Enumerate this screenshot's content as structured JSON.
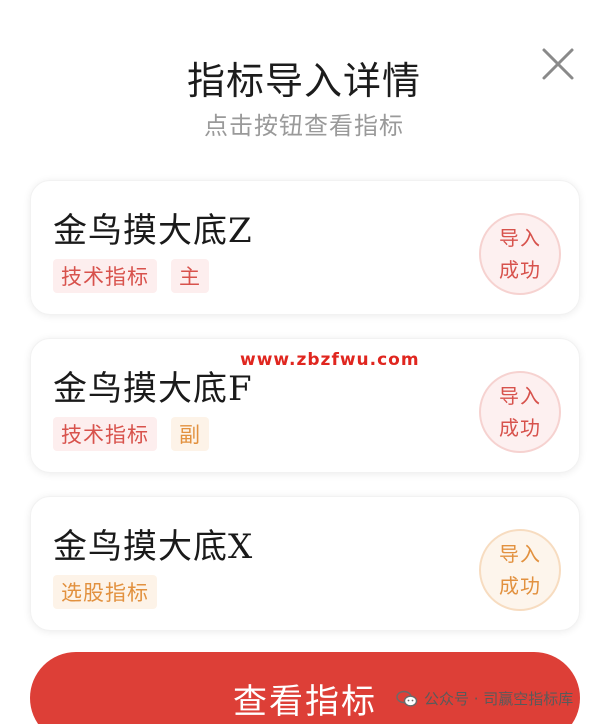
{
  "dialog": {
    "title": "指标导入详情",
    "subtitle": "点击按钮查看指标",
    "close_icon": "close-icon"
  },
  "indicators": [
    {
      "name": "金鸟摸大底Z",
      "tags": [
        "技术指标",
        "主"
      ],
      "tag_style": [
        "red",
        "red"
      ],
      "status_line1": "导入",
      "status_line2": "成功",
      "status_color": "red"
    },
    {
      "name": "金鸟摸大底F",
      "tags": [
        "技术指标",
        "副"
      ],
      "tag_style": [
        "red",
        "orange"
      ],
      "status_line1": "导入",
      "status_line2": "成功",
      "status_color": "red"
    },
    {
      "name": "金鸟摸大底X",
      "tags": [
        "选股指标"
      ],
      "tag_style": [
        "orange"
      ],
      "status_line1": "导入",
      "status_line2": "成功",
      "status_color": "orange"
    }
  ],
  "watermark": "www.zbzfwu.com",
  "button": {
    "label": "查看指标"
  },
  "credit": {
    "text": "公众号 · 司赢空指标库",
    "icon": "wechat-icon"
  },
  "colors": {
    "accent": "#dd3f37",
    "tag_red": "#d8524c",
    "tag_orange": "#e2913f"
  }
}
